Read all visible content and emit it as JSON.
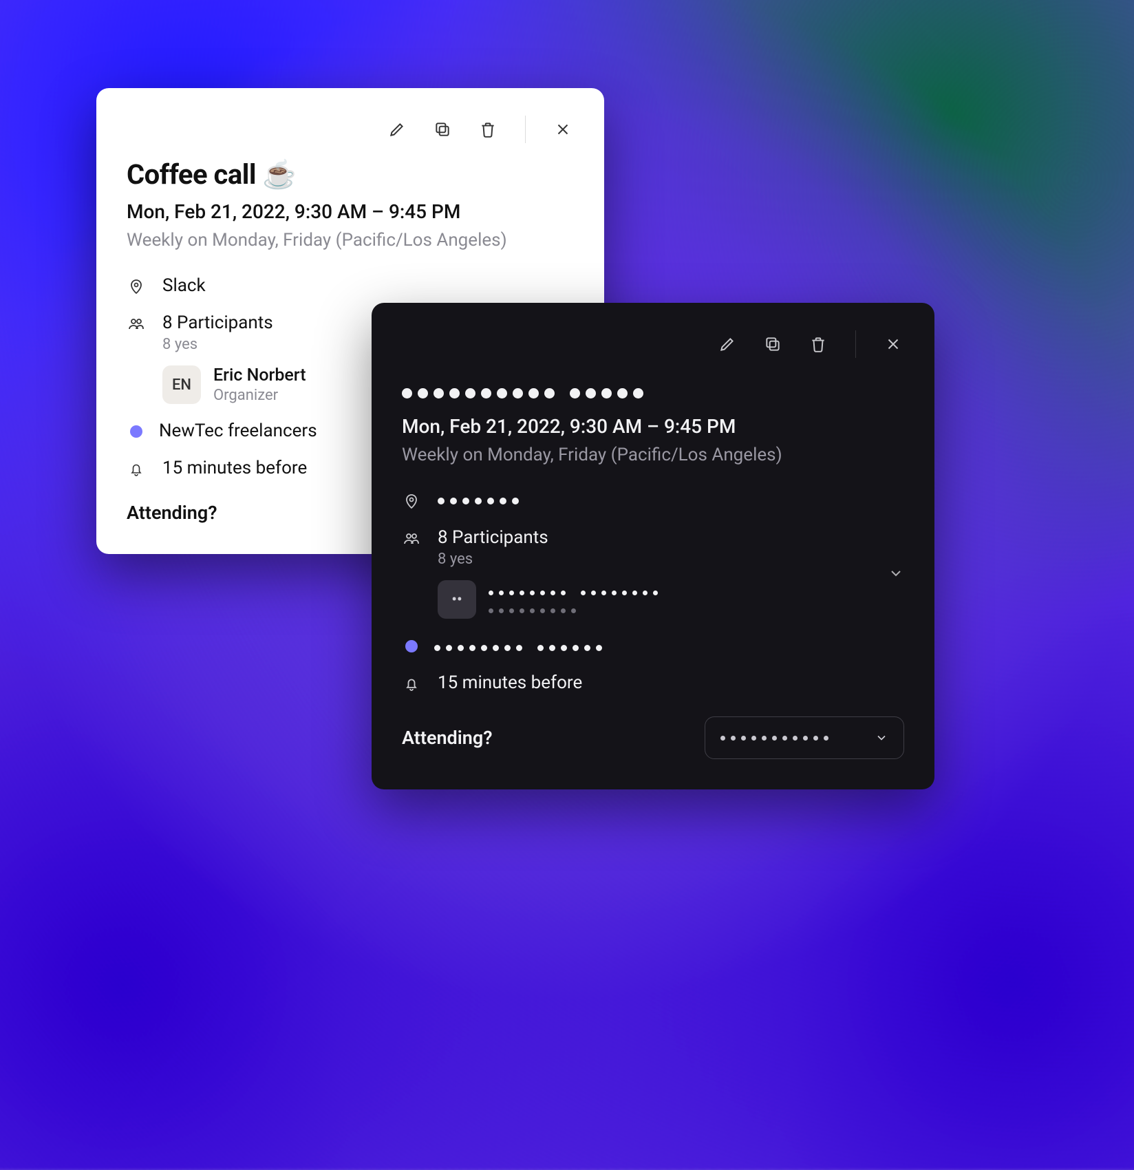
{
  "light": {
    "title": "Coffee call ☕",
    "datetime": "Mon, Feb 21, 2022, 9:30 AM – 9:45 PM",
    "recurrence": "Weekly on Monday, Friday (Pacific/Los Angeles)",
    "location": "Slack",
    "participants_label": "8 Participants",
    "participants_sub": "8 yes",
    "organizer_initials": "EN",
    "organizer_name": "Eric Norbert",
    "organizer_role": "Organizer",
    "calendar_name": "NewTec freelancers",
    "reminder": "15 minutes before",
    "attending_label": "Attending?"
  },
  "dark": {
    "title_dots_a": 10,
    "title_dots_b": 5,
    "datetime": "Mon, Feb 21, 2022, 9:30 AM – 9:45 PM",
    "recurrence": "Weekly on Monday, Friday (Pacific/Los Angeles)",
    "location_dots": 7,
    "participants_label": "8 Participants",
    "participants_sub": "8 yes",
    "organizer_initials": "••",
    "organizer_name_dots_a": 8,
    "organizer_name_dots_b": 8,
    "organizer_role_dots": 9,
    "calendar_dots_a": 8,
    "calendar_dots_b": 6,
    "reminder": "15 minutes before",
    "attending_label": "Attending?",
    "select_dots": 11
  },
  "colors": {
    "calendar_dot": "#7b79ff"
  }
}
